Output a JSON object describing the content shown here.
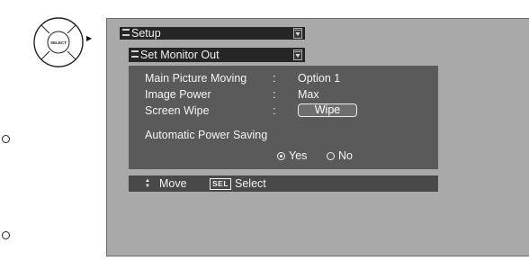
{
  "remote": {
    "center_label": "SELECT",
    "right_arrow": "▶"
  },
  "menu": {
    "title": "Setup",
    "submenu": "Set Monitor Out"
  },
  "settings": [
    {
      "label": "Main Picture Moving",
      "sep": ":",
      "value": "Option 1"
    },
    {
      "label": "Image Power",
      "sep": ":",
      "value": "Max"
    },
    {
      "label": "Screen Wipe",
      "sep": ":",
      "button": "Wipe"
    }
  ],
  "power_saving": {
    "label": "Automatic Power Saving",
    "options": [
      {
        "label": "Yes",
        "selected": true
      },
      {
        "label": "No",
        "selected": false
      }
    ]
  },
  "footer": {
    "move_label": "Move",
    "sel_key": "SEL",
    "select_label": "Select"
  },
  "colors": {
    "screen_bg": "#a9a9a9",
    "panel_bg": "#5a5a5a",
    "bar_bg": "#262626",
    "text": "#f4f4f4"
  }
}
